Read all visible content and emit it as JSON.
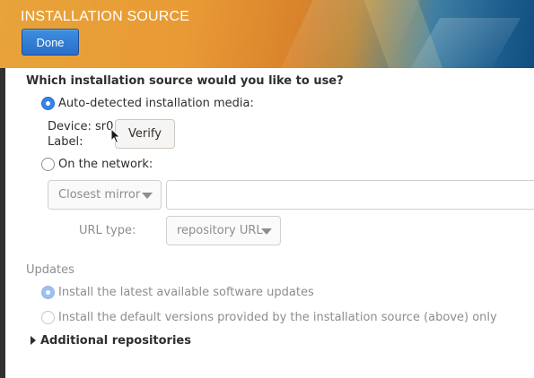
{
  "header": {
    "title": "INSTALLATION SOURCE",
    "done_label": "Done"
  },
  "source": {
    "question": "Which installation source would you like to use?",
    "auto_label": "Auto-detected installation media:",
    "auto_selected": true,
    "device_label": "Device: sr0",
    "label_label": "Label:",
    "verify_label": "Verify",
    "network_label": "On the network:",
    "network_selected": false,
    "protocol_value": "Closest mirror",
    "url_value": "",
    "url_type_label": "URL type:",
    "url_type_value": "repository URL"
  },
  "updates": {
    "heading": "Updates",
    "latest_label": "Install the latest available software updates",
    "latest_selected": true,
    "default_label": "Install the default versions provided by the installation source (above) only",
    "default_selected": false
  },
  "additional": {
    "label": "Additional repositories",
    "expanded": false
  }
}
